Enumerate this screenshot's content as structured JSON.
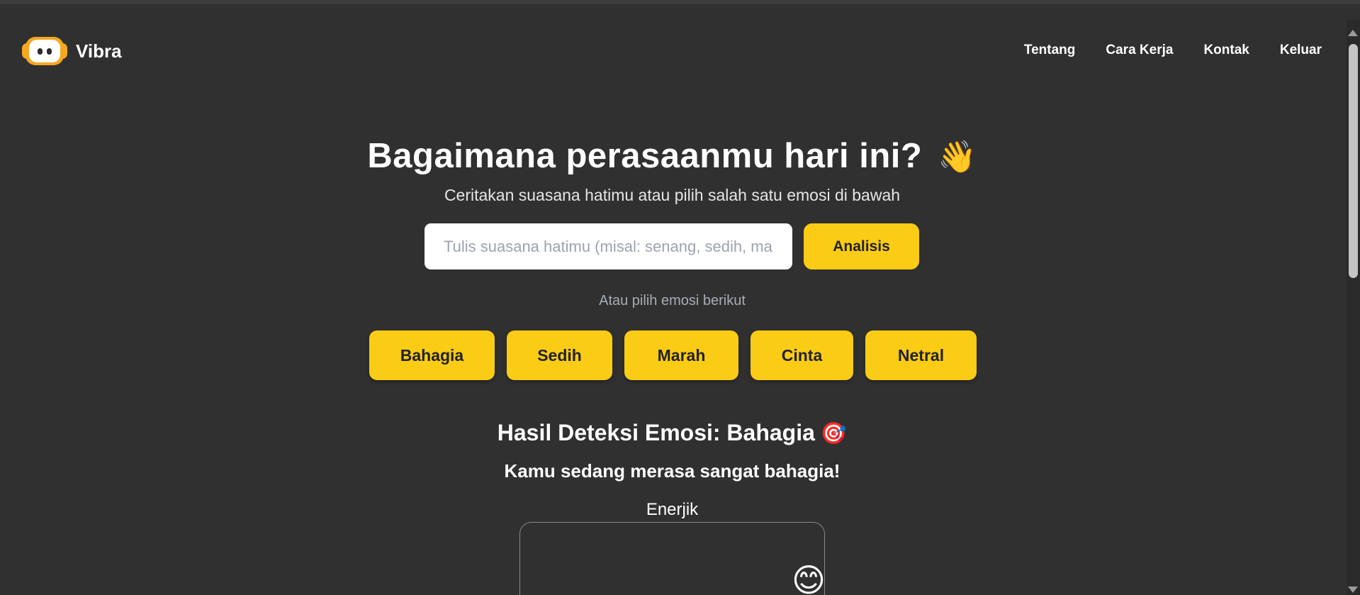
{
  "brand": {
    "name": "Vibra",
    "logo_icon": "robot-face-icon",
    "logo_color": "#f6a821"
  },
  "nav": {
    "items": [
      "Tentang",
      "Cara Kerja",
      "Kontak",
      "Keluar"
    ]
  },
  "hero": {
    "title": "Bagaimana perasaanmu hari ini?",
    "title_emoji": "👋",
    "subtitle": "Ceritakan suasana hatimu atau pilih salah satu emosi di bawah"
  },
  "search": {
    "placeholder": "Tulis suasana hatimu (misal: senang, sedih, marah...)",
    "value": "",
    "button_label": "Analisis"
  },
  "choices": {
    "prompt": "Atau pilih emosi berikut",
    "items": [
      "Bahagia",
      "Sedih",
      "Marah",
      "Cinta",
      "Netral"
    ]
  },
  "result": {
    "title": "Hasil Deteksi Emosi: Bahagia",
    "title_emoji": "🎯",
    "message": "Kamu sedang merasa sangat bahagia!",
    "energy_label": "Enerjik",
    "energy_emoji": "😊"
  },
  "colors": {
    "background": "#303030",
    "accent": "#facc15",
    "text": "#ffffff"
  }
}
